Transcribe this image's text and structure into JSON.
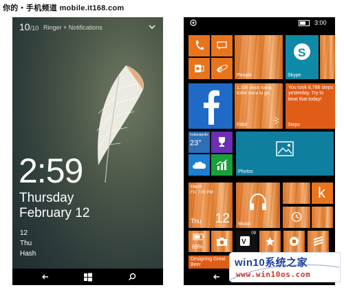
{
  "watermark_top": "你的・手机频道 mobile.it168.com",
  "lock_screen": {
    "notif_count": "10",
    "notif_total": "/10",
    "ringer_label": "Ringer + Notifications",
    "time": "2:59",
    "day": "Thursday",
    "date": "February 12",
    "event_day": "12",
    "event_weekday": "Thu",
    "event_title": "Hash"
  },
  "start_screen": {
    "status_time": "3:00",
    "tiles": {
      "people_label": "People",
      "skype_label": "Skype",
      "fitbit_text": "1,336 steps today. 6364 more to go.",
      "fitbit_label": "Fitbit",
      "steps_text": "You took 6,788 steps yesterday. Try to beat that today!",
      "steps_label": "Steps",
      "weather_city": "Indianapolis",
      "weather_temp": "23°",
      "photos_label": "Photos",
      "calendar_event": "Hash",
      "calendar_time": "Fri: 7:00 PM",
      "calendar_day": "Thu",
      "calendar_date": "12",
      "music_label": "Music",
      "k_letter": "k",
      "battery_pct": "69%",
      "vine_badge": "09",
      "designing_text": "Designing Great Beer"
    }
  },
  "watermark_brand": "win10系统之家",
  "watermark_url": "www.win10os.com"
}
